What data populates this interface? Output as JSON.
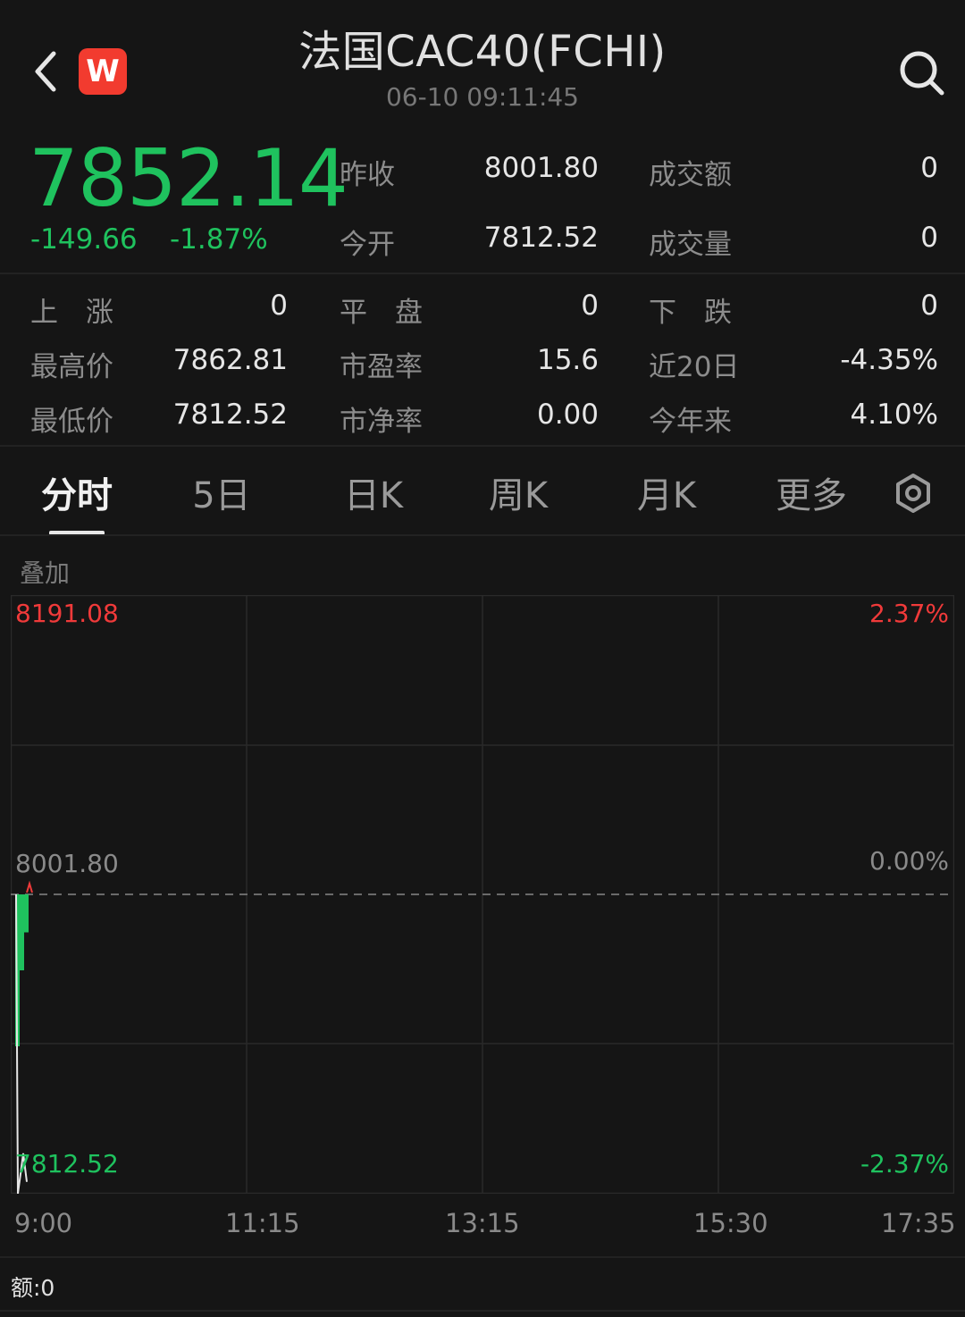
{
  "header": {
    "app_badge": "W",
    "title": "法国CAC40(FCHI)",
    "timestamp": "06-10 09:11:45"
  },
  "quote": {
    "price": "7852.14",
    "change": "-149.66",
    "change_pct": "-1.87%",
    "prev_close_label": "昨收",
    "prev_close": "8001.80",
    "open_label": "今开",
    "open": "7812.52",
    "turnover_label": "成交额",
    "turnover": "0",
    "volume_label": "成交量",
    "volume": "0"
  },
  "stats": {
    "rise_label": "上　涨",
    "rise": "0",
    "flat_label": "平　盘",
    "flat": "0",
    "fall_label": "下　跌",
    "fall": "0",
    "high_label": "最高价",
    "high": "7862.81",
    "pe_label": "市盈率",
    "pe": "15.6",
    "d20_label": "近20日",
    "d20": "-4.35%",
    "low_label": "最低价",
    "low": "7812.52",
    "pb_label": "市净率",
    "pb": "0.00",
    "ytd_label": "今年来",
    "ytd": "4.10%"
  },
  "tabs": [
    {
      "label": "分时",
      "active": true
    },
    {
      "label": "5日"
    },
    {
      "label": "日K"
    },
    {
      "label": "周K"
    },
    {
      "label": "月K"
    },
    {
      "label": "更多"
    }
  ],
  "overlay_label": "叠加",
  "amount_label": "额:0",
  "colors": {
    "up": "#f03a3a",
    "down": "#1fc25e",
    "neutral": "#8a8a8a",
    "background": "#151515"
  },
  "chart_data": {
    "type": "line",
    "y_max_label": "8191.08",
    "y_mid_label": "8001.80",
    "y_min_label": "7812.52",
    "pct_max_label": "2.37%",
    "pct_mid_label": "0.00%",
    "pct_min_label": "-2.37%",
    "x_labels": [
      "9:00",
      "11:15",
      "13:15",
      "15:30",
      "17:35"
    ],
    "ylim": [
      7812.52,
      8191.08
    ],
    "reference": 8001.8,
    "series": [
      {
        "values": [
          8001.8,
          7812.52,
          7825.0,
          7838.0,
          7820.0
        ]
      }
    ],
    "volume_bars": [
      {
        "value": 1.0,
        "dir": "down"
      },
      {
        "value": 0.5,
        "dir": "down"
      },
      {
        "value": 0.25,
        "dir": "down"
      }
    ]
  }
}
